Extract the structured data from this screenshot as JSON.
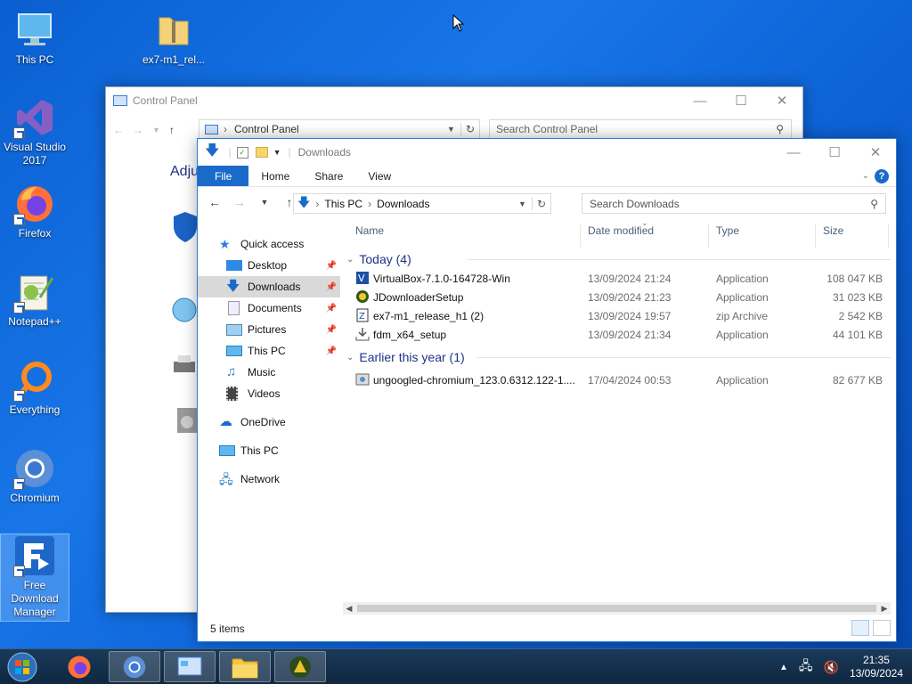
{
  "desktop": {
    "icons": [
      {
        "label": "This PC",
        "icon": "computer-icon"
      },
      {
        "label": "ex7-m1_rel...",
        "icon": "folder-zip-icon"
      },
      {
        "label": "Visual Studio 2017",
        "icon": "visual-studio-icon"
      },
      {
        "label": "Firefox",
        "icon": "firefox-icon"
      },
      {
        "label": "Notepad++",
        "icon": "notepadpp-icon"
      },
      {
        "label": "Everything",
        "icon": "everything-search-icon"
      },
      {
        "label": "Chromium",
        "icon": "chromium-icon"
      },
      {
        "label": "Free Download Manager",
        "icon": "fdm-icon"
      }
    ]
  },
  "control_panel": {
    "title": "Control Panel",
    "address": "Control Panel",
    "search_placeholder": "Search Control Panel",
    "heading_partial": "Adju"
  },
  "explorer": {
    "title": "Downloads",
    "tabs": [
      "File",
      "Home",
      "Share",
      "View"
    ],
    "address": {
      "root": "This PC",
      "folder": "Downloads"
    },
    "search_placeholder": "Search Downloads",
    "nav": {
      "quick_access": "Quick access",
      "quick_items": [
        {
          "label": "Desktop",
          "pinned": true
        },
        {
          "label": "Downloads",
          "pinned": true,
          "active": true
        },
        {
          "label": "Documents",
          "pinned": true
        },
        {
          "label": "Pictures",
          "pinned": true
        },
        {
          "label": "This PC",
          "pinned": true
        },
        {
          "label": "Music",
          "pinned": false
        },
        {
          "label": "Videos",
          "pinned": false
        }
      ],
      "onedrive": "OneDrive",
      "this_pc": "This PC",
      "network": "Network"
    },
    "columns": {
      "name": "Name",
      "date": "Date modified",
      "type": "Type",
      "size": "Size"
    },
    "groups": [
      {
        "label": "Today (4)",
        "files": [
          {
            "name": "VirtualBox-7.1.0-164728-Win",
            "date": "13/09/2024 21:24",
            "type": "Application",
            "size": "108 047 KB",
            "icon": "virtualbox-icon"
          },
          {
            "name": "JDownloaderSetup",
            "date": "13/09/2024 21:23",
            "type": "Application",
            "size": "31 023 KB",
            "icon": "jdownloader-icon"
          },
          {
            "name": "ex7-m1_release_h1 (2)",
            "date": "13/09/2024 19:57",
            "type": "zip Archive",
            "size": "2 542 KB",
            "icon": "zip-archive-icon"
          },
          {
            "name": "fdm_x64_setup",
            "date": "13/09/2024 21:34",
            "type": "Application",
            "size": "44 101 KB",
            "icon": "installer-icon"
          }
        ]
      },
      {
        "label": "Earlier this year (1)",
        "files": [
          {
            "name": "ungoogled-chromium_123.0.6312.122-1....",
            "date": "17/04/2024 00:53",
            "type": "Application",
            "size": "82 677 KB",
            "icon": "installer-icon"
          }
        ]
      }
    ],
    "status": "5 items"
  },
  "taskbar": {
    "time": "21:35",
    "date": "13/09/2024"
  },
  "colors": {
    "desktop_blue": "#0d63d6",
    "file_tab": "#1a6bc9",
    "group_header": "#1e3287"
  }
}
